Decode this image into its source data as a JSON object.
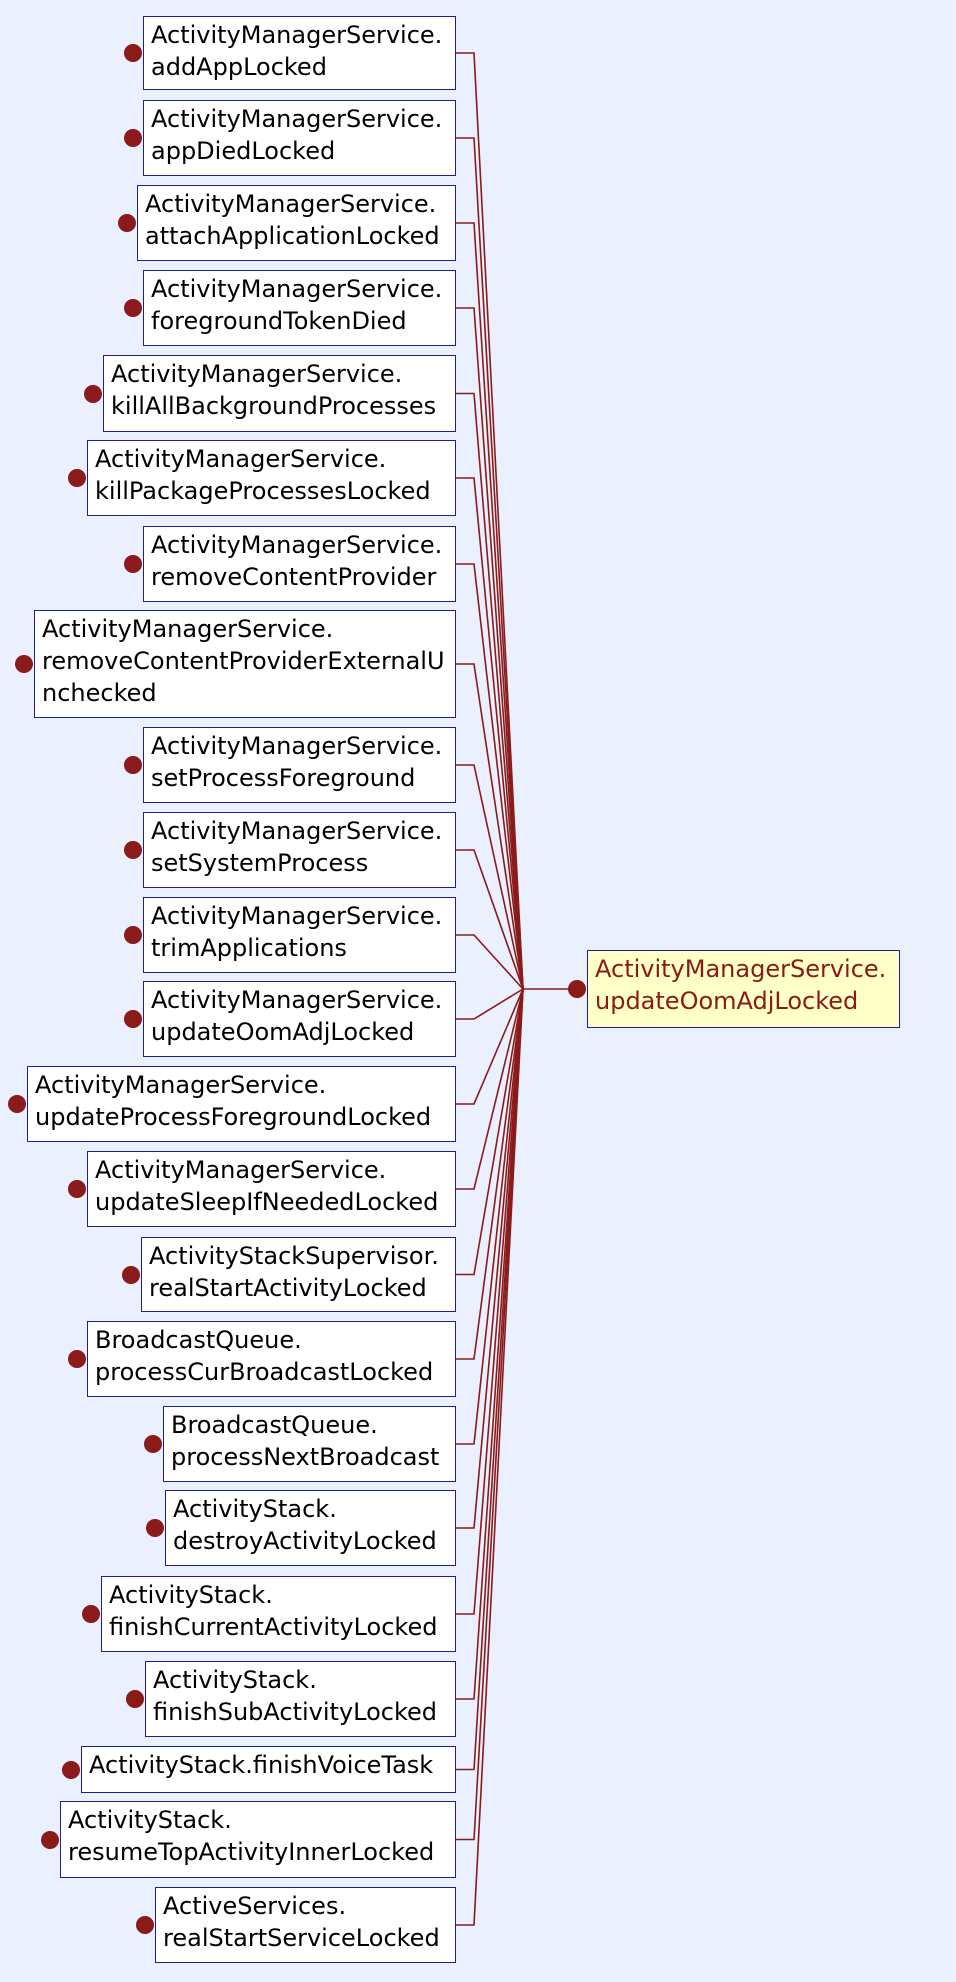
{
  "target": {
    "lines": [
      "ActivityManagerService.",
      "updateOomAdjLocked"
    ]
  },
  "callers": [
    {
      "lines": [
        "ActivityManagerService.",
        "addAppLocked"
      ]
    },
    {
      "lines": [
        "ActivityManagerService.",
        "appDiedLocked"
      ]
    },
    {
      "lines": [
        "ActivityManagerService.",
        "attachApplicationLocked"
      ]
    },
    {
      "lines": [
        "ActivityManagerService.",
        "foregroundTokenDied"
      ]
    },
    {
      "lines": [
        "ActivityManagerService.",
        "killAllBackgroundProcesses"
      ]
    },
    {
      "lines": [
        "ActivityManagerService.",
        "killPackageProcessesLocked"
      ]
    },
    {
      "lines": [
        "ActivityManagerService.",
        "removeContentProvider"
      ]
    },
    {
      "lines": [
        "ActivityManagerService.",
        "removeContentProviderExternalU",
        "nchecked"
      ]
    },
    {
      "lines": [
        "ActivityManagerService.",
        "setProcessForeground"
      ]
    },
    {
      "lines": [
        "ActivityManagerService.",
        "setSystemProcess"
      ]
    },
    {
      "lines": [
        "ActivityManagerService.",
        "trimApplications"
      ]
    },
    {
      "lines": [
        "ActivityManagerService.",
        "updateOomAdjLocked"
      ]
    },
    {
      "lines": [
        "ActivityManagerService.",
        "updateProcessForegroundLocked"
      ]
    },
    {
      "lines": [
        "ActivityManagerService.",
        "updateSleepIfNeededLocked"
      ]
    },
    {
      "lines": [
        "ActivityStackSupervisor.",
        "realStartActivityLocked"
      ]
    },
    {
      "lines": [
        "BroadcastQueue.",
        "processCurBroadcastLocked"
      ]
    },
    {
      "lines": [
        "BroadcastQueue.",
        "processNextBroadcast"
      ]
    },
    {
      "lines": [
        "ActivityStack.",
        "destroyActivityLocked"
      ]
    },
    {
      "lines": [
        "ActivityStack.",
        "finishCurrentActivityLocked"
      ]
    },
    {
      "lines": [
        "ActivityStack.",
        "finishSubActivityLocked"
      ]
    },
    {
      "lines": [
        "ActivityStack.finishVoiceTask"
      ]
    },
    {
      "lines": [
        "ActivityStack.",
        "resumeTopActivityInnerLocked"
      ]
    },
    {
      "lines": [
        "ActiveServices.",
        "realStartServiceLocked"
      ]
    }
  ]
}
